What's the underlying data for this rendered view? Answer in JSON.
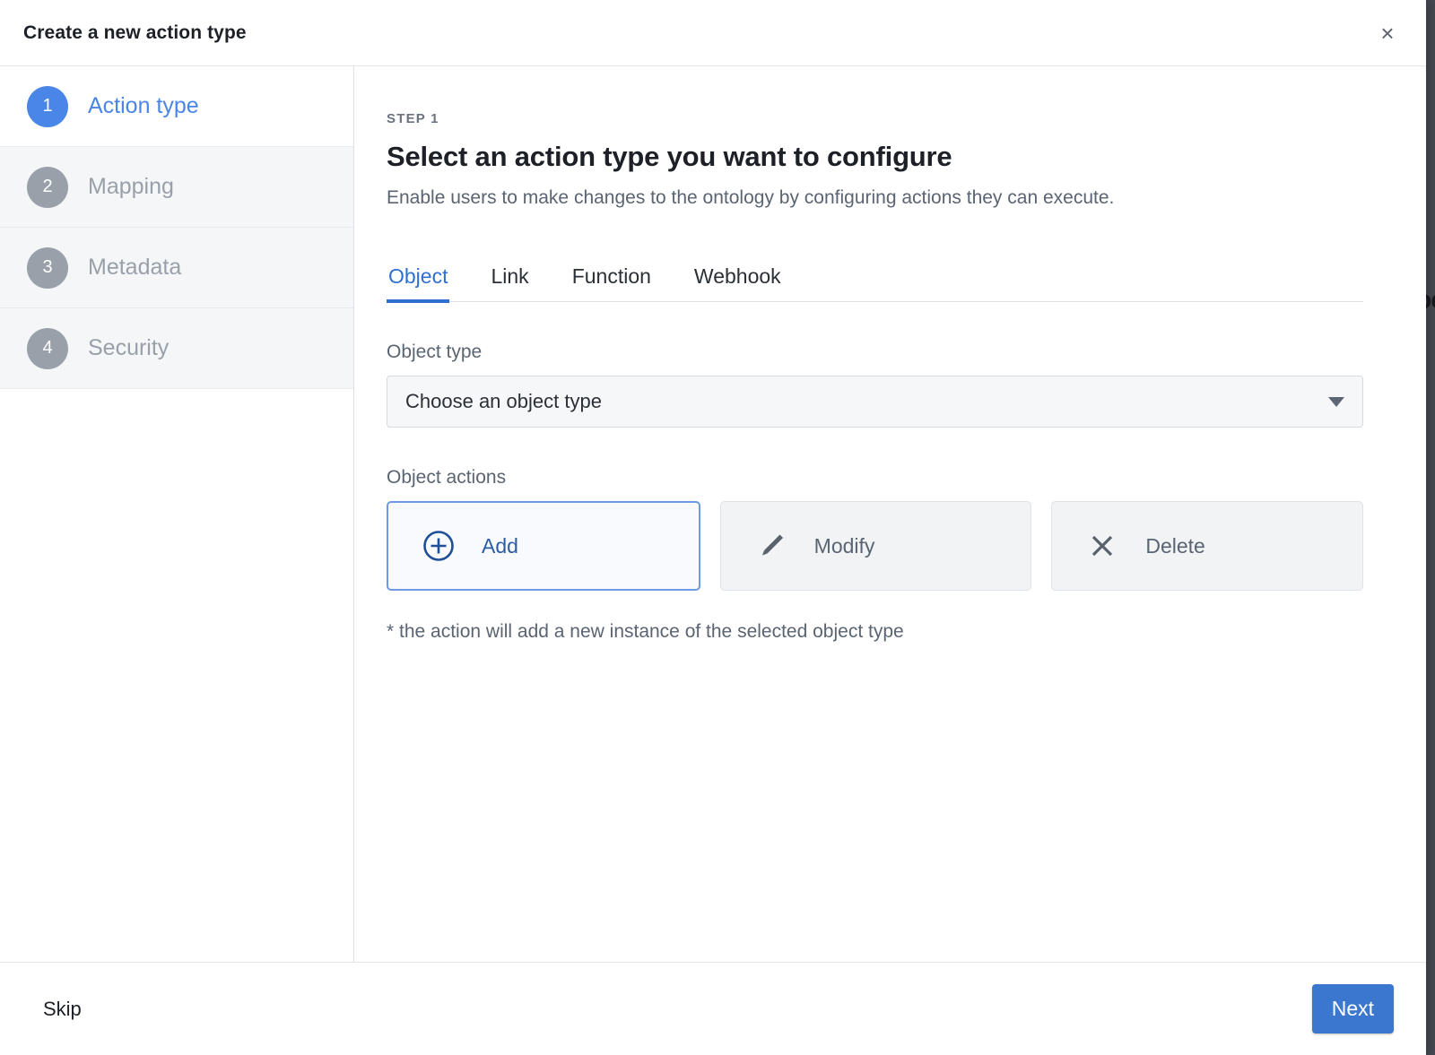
{
  "dialog": {
    "title": "Create a new action type",
    "close_label": "×"
  },
  "sidebar": {
    "steps": [
      {
        "number": "1",
        "label": "Action type"
      },
      {
        "number": "2",
        "label": "Mapping"
      },
      {
        "number": "3",
        "label": "Metadata"
      },
      {
        "number": "4",
        "label": "Security"
      }
    ]
  },
  "content": {
    "eyebrow": "STEP 1",
    "title": "Select an action type you want to configure",
    "subtitle": "Enable users to make changes to the ontology by configuring actions they can execute.",
    "tabs": [
      {
        "label": "Object"
      },
      {
        "label": "Link"
      },
      {
        "label": "Function"
      },
      {
        "label": "Webhook"
      }
    ],
    "object_type": {
      "label": "Object type",
      "selected": "Choose an object type"
    },
    "object_actions": {
      "label": "Object actions",
      "items": [
        {
          "label": "Add",
          "icon": "plus-circle-icon"
        },
        {
          "label": "Modify",
          "icon": "pencil-icon"
        },
        {
          "label": "Delete",
          "icon": "close-x-icon"
        }
      ]
    },
    "hint": "* the action will add a new instance of the selected object type"
  },
  "footer": {
    "skip_label": "Skip",
    "next_label": "Next"
  },
  "background": {
    "partial_text": "oc"
  },
  "colors": {
    "accent_blue": "#4a86e8",
    "tab_active_blue": "#2f6fd0",
    "primary_button_blue": "#3b77cf",
    "selected_card_border": "#6c9ae4",
    "muted_text": "#5a6472"
  }
}
